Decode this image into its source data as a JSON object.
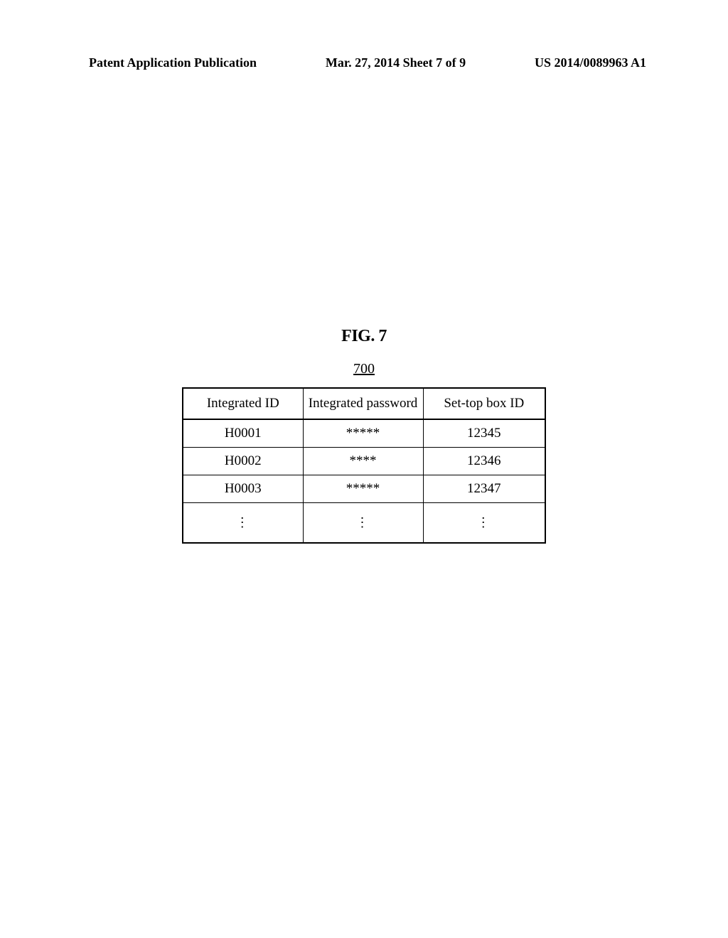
{
  "header": {
    "left": "Patent Application Publication",
    "center": "Mar. 27, 2014  Sheet 7 of 9",
    "right": "US 2014/0089963 A1"
  },
  "figure": {
    "title": "FIG. 7",
    "number": "700"
  },
  "table": {
    "headers": {
      "col1": "Integrated ID",
      "col2": "Integrated password",
      "col3": "Set-top box ID"
    },
    "rows": [
      {
        "col1": "H0001",
        "col2": "*****",
        "col3": "12345"
      },
      {
        "col1": "H0002",
        "col2": "****",
        "col3": "12346"
      },
      {
        "col1": "H0003",
        "col2": "*****",
        "col3": "12347"
      }
    ],
    "ellipsis": "⋮"
  }
}
